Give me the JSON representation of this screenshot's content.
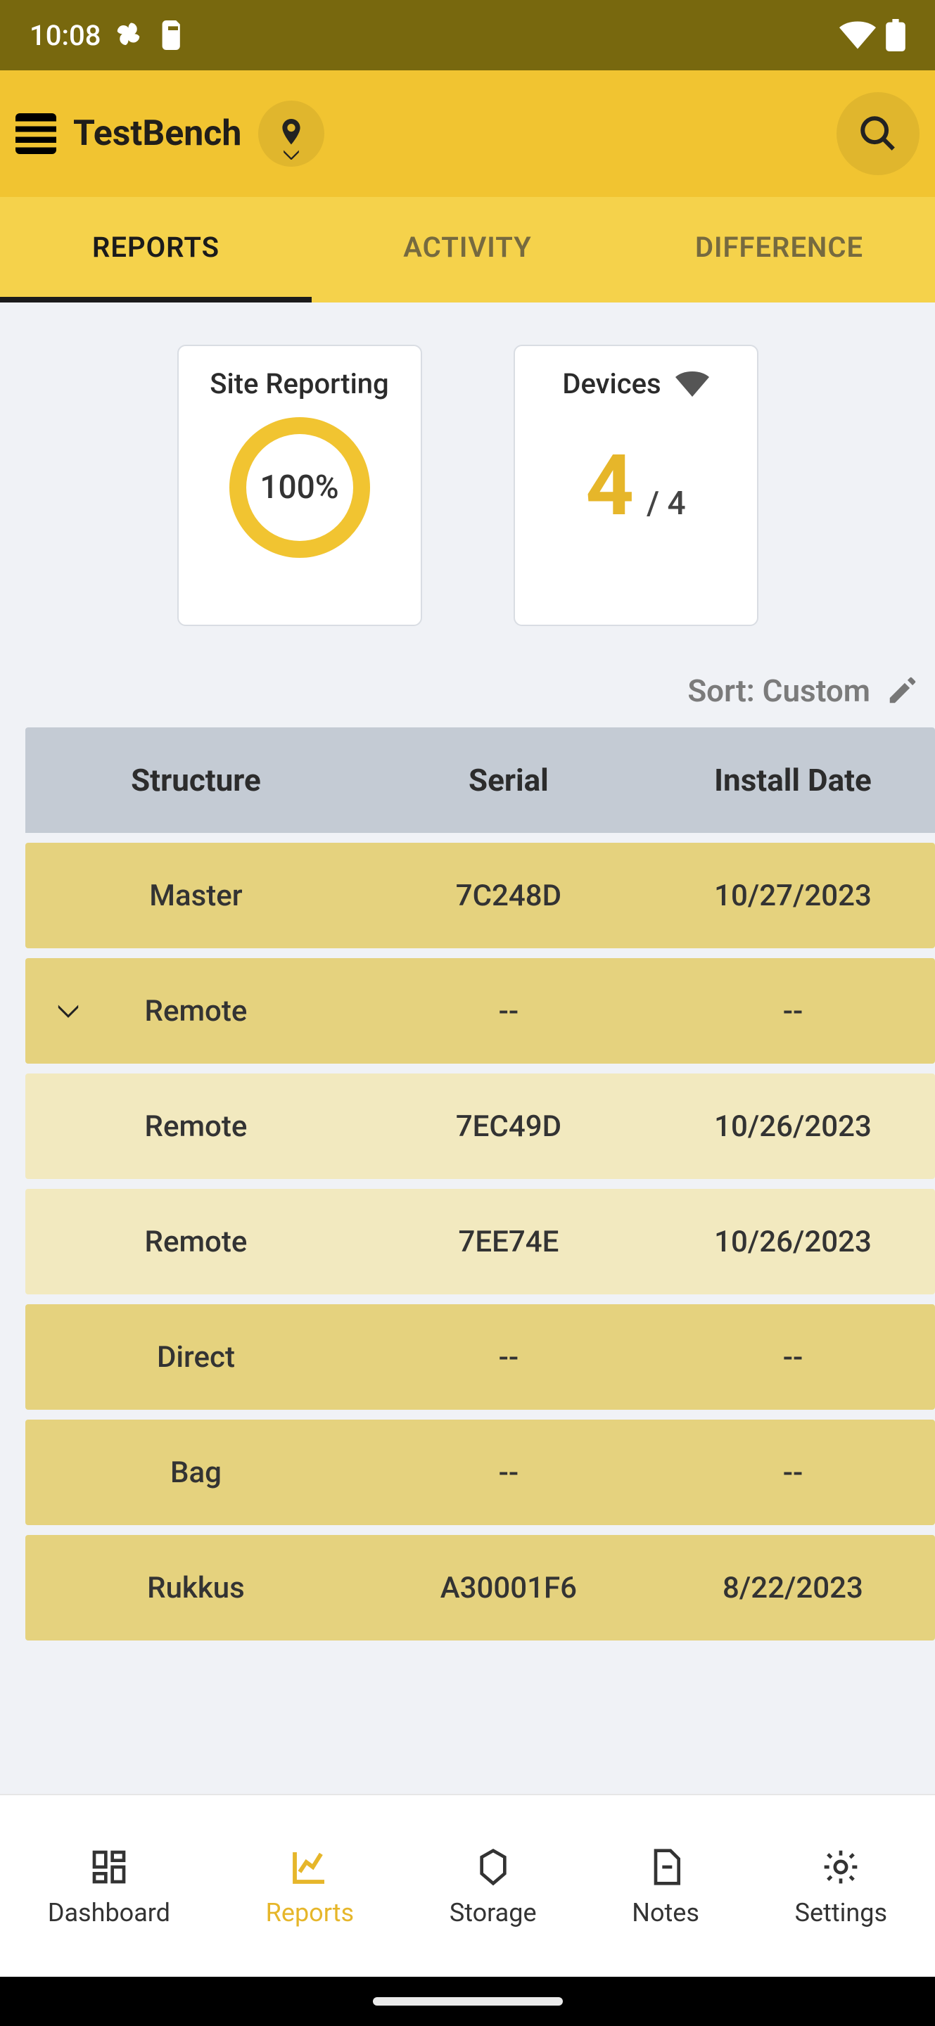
{
  "statusbar": {
    "time": "10:08"
  },
  "header": {
    "title": "TestBench"
  },
  "tabs": {
    "reports": "REPORTS",
    "activity": "ACTIVITY",
    "difference": "DIFFERENCE"
  },
  "cards": {
    "site_reporting": {
      "title": "Site Reporting",
      "percent": "100%"
    },
    "devices": {
      "title": "Devices",
      "count": "4",
      "sep": "  /  ",
      "total": "4"
    }
  },
  "sort": {
    "label": "Sort: Custom"
  },
  "table": {
    "headers": {
      "structure": "Structure",
      "serial": "Serial",
      "install_date": "Install Date"
    },
    "rows": [
      {
        "structure": "Master",
        "serial": "7C248D",
        "install_date": "10/27/2023",
        "shade": "dark",
        "chevron": false
      },
      {
        "structure": "Remote",
        "serial": "--",
        "install_date": "--",
        "shade": "dark",
        "chevron": true
      },
      {
        "structure": "Remote",
        "serial": "7EC49D",
        "install_date": "10/26/2023",
        "shade": "light",
        "chevron": false
      },
      {
        "structure": "Remote",
        "serial": "7EE74E",
        "install_date": "10/26/2023",
        "shade": "light",
        "chevron": false
      },
      {
        "structure": "Direct",
        "serial": "--",
        "install_date": "--",
        "shade": "dark",
        "chevron": false
      },
      {
        "structure": "Bag",
        "serial": "--",
        "install_date": "--",
        "shade": "dark",
        "chevron": false
      },
      {
        "structure": "Rukkus",
        "serial": "A30001F6",
        "install_date": "8/22/2023",
        "shade": "dark",
        "chevron": false
      }
    ]
  },
  "bottom_nav": {
    "dashboard": "Dashboard",
    "reports": "Reports",
    "storage": "Storage",
    "notes": "Notes",
    "settings": "Settings"
  }
}
